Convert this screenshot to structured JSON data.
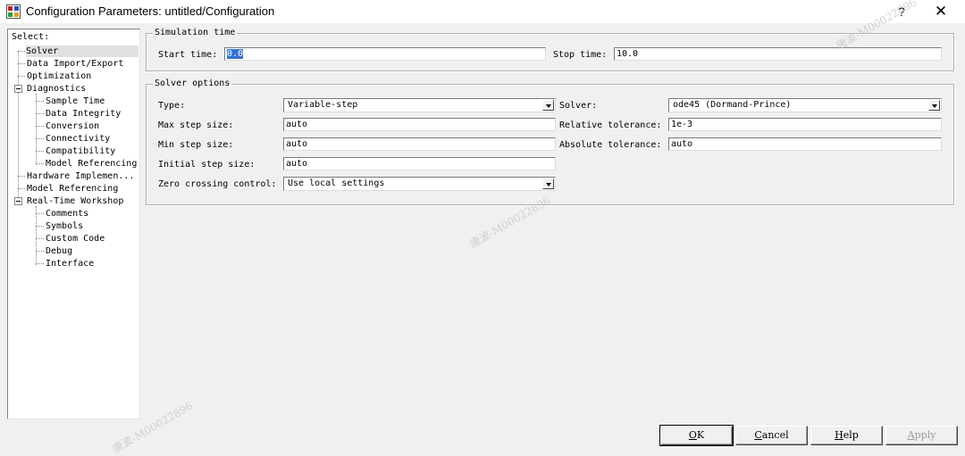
{
  "window": {
    "title": "Configuration Parameters: untitled/Configuration",
    "help_glyph": "?",
    "close_glyph": "✕"
  },
  "tree": {
    "header": "Select:",
    "items": [
      {
        "label": "Solver"
      },
      {
        "label": "Data Import/Export"
      },
      {
        "label": "Optimization"
      },
      {
        "label": "Diagnostics"
      },
      {
        "label": "Sample Time"
      },
      {
        "label": "Data Integrity"
      },
      {
        "label": "Conversion"
      },
      {
        "label": "Connectivity"
      },
      {
        "label": "Compatibility"
      },
      {
        "label": "Model Referencing"
      },
      {
        "label": "Hardware Implemen..."
      },
      {
        "label": "Model Referencing"
      },
      {
        "label": "Real-Time Workshop"
      },
      {
        "label": "Comments"
      },
      {
        "label": "Symbols"
      },
      {
        "label": "Custom Code"
      },
      {
        "label": "Debug"
      },
      {
        "label": "Interface"
      }
    ]
  },
  "simulation_time": {
    "group_label": "Simulation time",
    "start_label": "Start time:",
    "start_value": "0.0",
    "stop_label": "Stop time:",
    "stop_value": "10.0"
  },
  "solver_options": {
    "group_label": "Solver options",
    "type_label": "Type:",
    "type_value": "Variable-step",
    "solver_label": "Solver:",
    "solver_value": "ode45 (Dormand-Prince)",
    "max_step_label": "Max step size:",
    "max_step_value": "auto",
    "rel_tol_label": "Relative tolerance:",
    "rel_tol_value": "1e-3",
    "min_step_label": "Min step size:",
    "min_step_value": "auto",
    "abs_tol_label": "Absolute tolerance:",
    "abs_tol_value": "auto",
    "init_step_label": "Initial step size:",
    "init_step_value": "auto",
    "zero_cross_label": "Zero crossing control:",
    "zero_cross_value": "Use local settings"
  },
  "buttons": {
    "ok_u": "O",
    "ok_rest": "K",
    "cancel_u": "C",
    "cancel_rest": "ancel",
    "help_u": "H",
    "help_rest": "elp",
    "apply_u": "A",
    "apply_rest": "pply"
  },
  "watermarks": {
    "wm1": "唐波-M00022896",
    "wm2": "唐波-M00022896",
    "wm3": "唐波-M00022896"
  }
}
